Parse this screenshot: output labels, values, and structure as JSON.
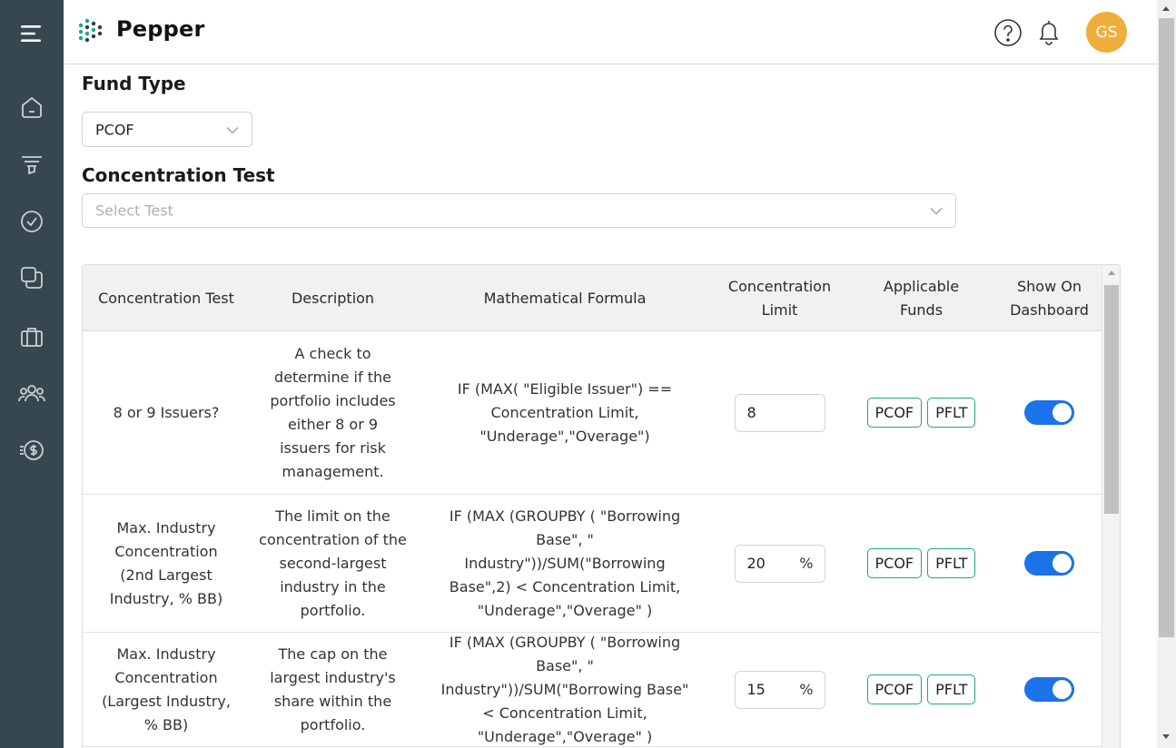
{
  "app": {
    "name": "Pepper"
  },
  "header": {
    "avatar_initials": "GS",
    "help_icon": "help-circle-icon",
    "notification_icon": "bell-icon"
  },
  "sidebar": {
    "items": [
      {
        "name": "menu",
        "icon": "hamburger-menu-icon"
      },
      {
        "name": "home",
        "icon": "home-icon"
      },
      {
        "name": "filter",
        "icon": "funnel-icon"
      },
      {
        "name": "approvals",
        "icon": "check-circle-icon"
      },
      {
        "name": "documents",
        "icon": "stacked-documents-icon"
      },
      {
        "name": "portfolio",
        "icon": "briefcase-icon"
      },
      {
        "name": "users",
        "icon": "users-icon"
      },
      {
        "name": "finance",
        "icon": "dollar-coin-icon"
      }
    ]
  },
  "form": {
    "fund_type_label": "Fund Type",
    "fund_type_value": "PCOF",
    "concentration_test_label": "Concentration Test",
    "concentration_test_placeholder": "Select Test"
  },
  "table": {
    "columns": [
      "Concentration Test",
      "Description",
      "Mathematical Formula",
      "Concentration Limit",
      "Applicable Funds",
      "Show On Dashboard"
    ],
    "rows": [
      {
        "test": "8 or 9 Issuers?",
        "description": "A check to determine if the portfolio includes either 8 or 9 issuers for risk management.",
        "formula": "IF (MAX( \"Eligible Issuer\") == Concentration Limit, \"Underage\",\"Overage\")",
        "limit_value": "8",
        "limit_unit": "",
        "funds": [
          "PCOF",
          "PFLT"
        ],
        "show_on_dashboard": true
      },
      {
        "test": "Max. Industry Concentration (2nd Largest Industry, % BB)",
        "description": "The limit on the concentration of the second-largest industry in the portfolio.",
        "formula": "IF (MAX (GROUPBY ( \"Borrowing Base\", \" Industry\"))/SUM(\"Borrowing Base\",2) < Concentration Limit, \"Underage\",\"Overage\" )",
        "limit_value": "20",
        "limit_unit": "%",
        "funds": [
          "PCOF",
          "PFLT"
        ],
        "show_on_dashboard": true
      },
      {
        "test": "Max. Industry Concentration (Largest Industry, % BB)",
        "description": "The cap on the largest industry's share within the portfolio.",
        "formula": "IF (MAX (GROUPBY ( \"Borrowing Base\", \" Industry\"))/SUM(\"Borrowing Base\" < Concentration Limit, \"Underage\",\"Overage\" )",
        "limit_value": "15",
        "limit_unit": "%",
        "funds": [
          "PCOF",
          "PFLT"
        ],
        "show_on_dashboard": true
      }
    ]
  },
  "colors": {
    "sidebar_bg": "#37474f",
    "avatar_bg": "#f0ad3c",
    "chip_border": "#1aa68a",
    "toggle_on": "#1a73e8",
    "logo_teal": "#1aa68a"
  }
}
